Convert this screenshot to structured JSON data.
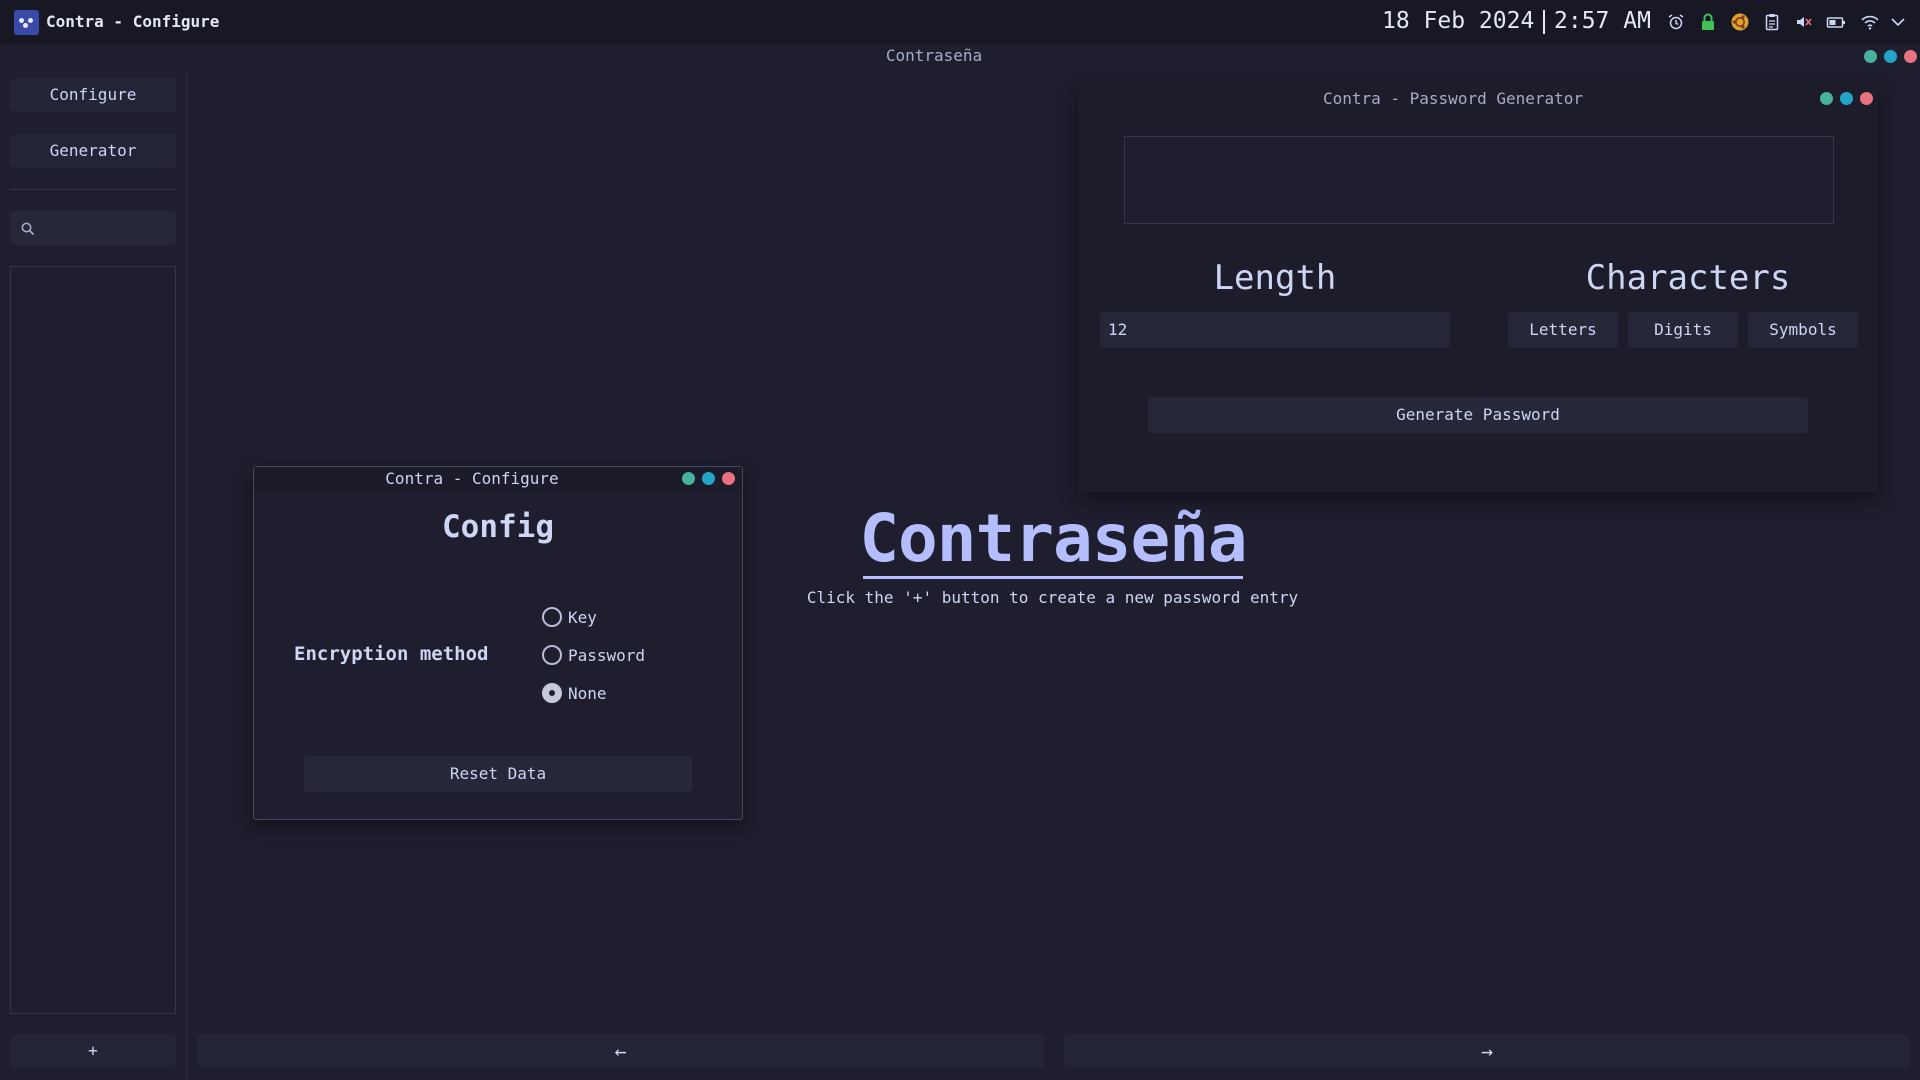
{
  "topbar": {
    "app_title": "Contra - Configure",
    "date": "18 Feb 2024",
    "time": "2:57 AM",
    "tray_icons": [
      "alarm-icon",
      "lock-icon",
      "ubuntu-icon",
      "clipboard-icon",
      "volume-muted-icon",
      "battery-icon",
      "wifi-icon",
      "chevron-down-icon"
    ]
  },
  "main_window": {
    "title": "Contraseña"
  },
  "sidebar": {
    "items": [
      {
        "label": "Configure"
      },
      {
        "label": "Generator"
      }
    ],
    "search": {
      "placeholder": "",
      "value": ""
    },
    "add_label": "+"
  },
  "nav": {
    "back_label": "←",
    "forward_label": "→"
  },
  "hero": {
    "title": "Contraseña",
    "subtitle": "Click the '+' button to create a new password entry"
  },
  "config_window": {
    "title": "Contra - Configure",
    "heading": "Config",
    "encryption_label": "Encryption method",
    "options": [
      {
        "label": "Key",
        "checked": false
      },
      {
        "label": "Password",
        "checked": false
      },
      {
        "label": "None",
        "checked": true
      }
    ],
    "reset_label": "Reset Data"
  },
  "generator_window": {
    "title": "Contra - Password Generator",
    "output_value": "",
    "length_heading": "Length",
    "length_value": "12",
    "characters_heading": "Characters",
    "char_options": [
      {
        "label": "Letters"
      },
      {
        "label": "Digits"
      },
      {
        "label": "Symbols"
      }
    ],
    "generate_label": "Generate Password"
  },
  "colors": {
    "background": "#1e1e2e",
    "accent": "#b4befe",
    "dot_green": "#45b39d",
    "dot_blue": "#22a5c9",
    "dot_red": "#e8727f"
  }
}
